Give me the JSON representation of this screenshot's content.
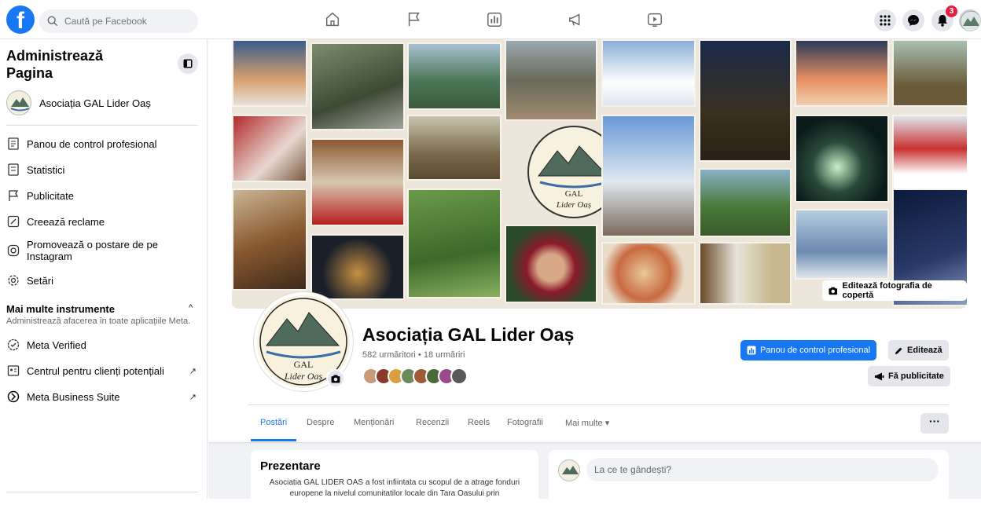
{
  "topbar": {
    "logo_letter": "f",
    "search_placeholder": "Caută pe Facebook",
    "notifications_count": "3"
  },
  "sidebar": {
    "title": "Administrează Pagina",
    "page_name": "Asociația GAL Lider Oaș",
    "items": [
      {
        "label": "Panou de control profesional",
        "icon": "dashboard-icon"
      },
      {
        "label": "Statistici",
        "icon": "insights-icon"
      },
      {
        "label": "Publicitate",
        "icon": "flag-icon"
      },
      {
        "label": "Creează reclame",
        "icon": "pencil-icon"
      },
      {
        "label": "Promovează o postare de pe Instagram",
        "icon": "instagram-icon"
      },
      {
        "label": "Setări",
        "icon": "gear-icon"
      }
    ],
    "more_tools_title": "Mai multe instrumente",
    "more_tools_subtitle": "Administrează afacerea în toate aplicațiile Meta.",
    "tools": [
      {
        "label": "Meta Verified",
        "icon": "verified-icon"
      },
      {
        "label": "Centrul pentru clienți potențiali",
        "icon": "leads-icon"
      },
      {
        "label": "Meta Business Suite",
        "icon": "meta-icon"
      }
    ]
  },
  "cover": {
    "edit_label": "Editează fotografia de copertă",
    "badge_text_1": "GAL",
    "badge_text_2": "Lider Oaș"
  },
  "profile": {
    "name": "Asociația GAL Lider Oaș",
    "stats": "582 urmăritori • 18 urmăriri",
    "pic_text_1": "GAL",
    "pic_text_2": "Lider Oaș"
  },
  "actions": {
    "dashboard": "Panou de control profesional",
    "edit": "Editează",
    "advertise": "Fă publicitate"
  },
  "tabs": [
    "Postări",
    "Despre",
    "Menționări",
    "Recenzii",
    "Reels",
    "Fotografii",
    "Mai multe ▾"
  ],
  "more_dots": "···",
  "intro": {
    "title": "Prezentare",
    "text": "Asociatia GAL LIDER OAS a fost infiintata cu scopul de a atrage fonduri europene la nivelul comunitatilor locale din Tara Oasului prin"
  },
  "composer": {
    "placeholder": "La ce te gândești?"
  }
}
